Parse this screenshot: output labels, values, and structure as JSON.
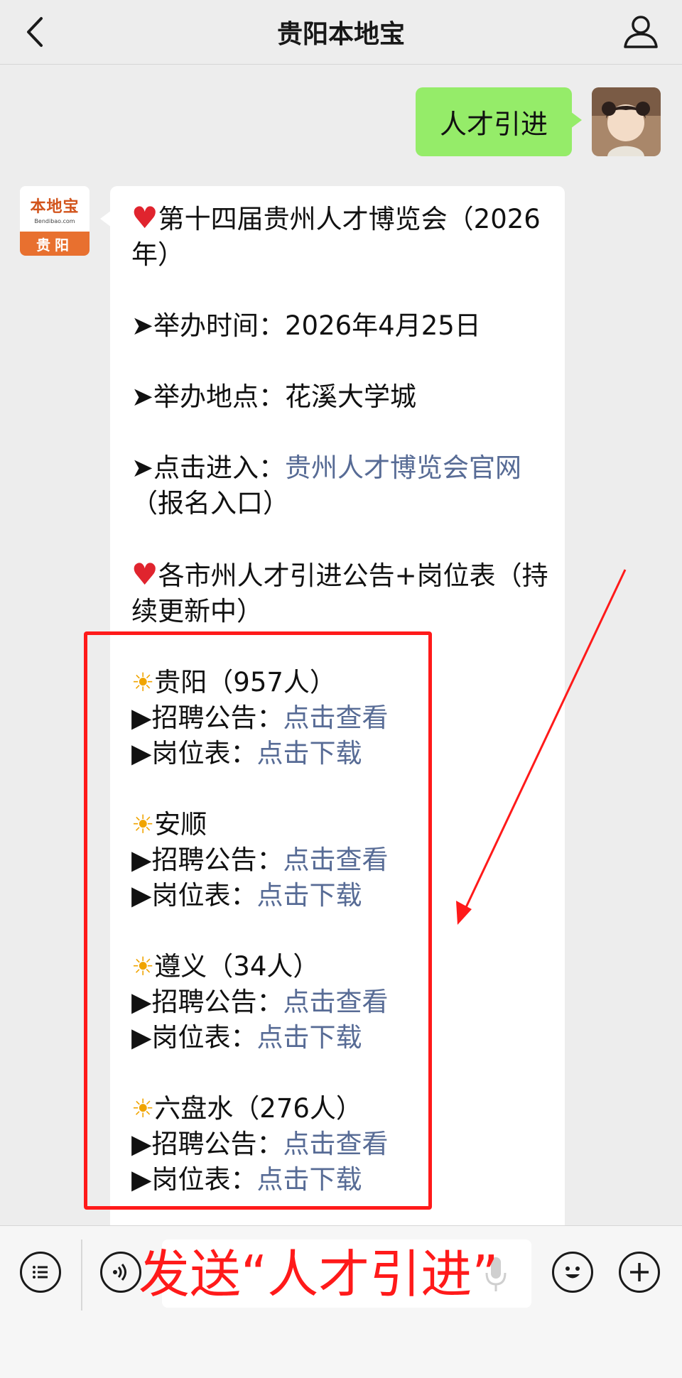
{
  "header": {
    "title": "贵阳本地宝",
    "back_icon": "chevron-left-icon",
    "profile_icon": "person-icon"
  },
  "sent_message": {
    "text": "人才引进"
  },
  "bot": {
    "avatar_logo": "本地宝",
    "avatar_sub": "Bendibao.com",
    "avatar_city": "贵阳"
  },
  "received_message": {
    "fair_heading": "第十四届贵州人才博览会（2026年）",
    "time_label": "➤举办时间：",
    "time_value": "2026年4月25日",
    "place_label": "➤举办地点：",
    "place_value": "花溪大学城",
    "enter_label": "➤点击进入：",
    "enter_link": "贵州人才博览会官网",
    "enter_suffix": "（报名入口）",
    "notice_heading": "各市州人才引进公告+岗位表（持续更新中）",
    "cities": [
      {
        "name": "贵阳（957人）",
        "notice_label": "▶招聘公告：",
        "notice_link": "点击查看",
        "table_label": "▶岗位表：",
        "table_link": "点击下载"
      },
      {
        "name": "安顺",
        "notice_label": "▶招聘公告：",
        "notice_link": "点击查看",
        "table_label": "▶岗位表：",
        "table_link": "点击下载"
      },
      {
        "name": "遵义（34人）",
        "notice_label": "▶招聘公告：",
        "notice_link": "点击查看",
        "table_label": "▶岗位表：",
        "table_link": "点击下载"
      },
      {
        "name": "六盘水（276人）",
        "notice_label": "▶招聘公告：",
        "notice_link": "点击查看",
        "table_label": "▶岗位表：",
        "table_link": "点击下载"
      }
    ]
  },
  "overlay_instruction": "发送“人才引进”",
  "input_bar": {
    "menu_icon": "list-menu-icon",
    "voice_icon": "voice-icon",
    "mic_icon": "microphone-icon",
    "emoji_icon": "emoji-icon",
    "plus_icon": "plus-icon"
  },
  "colors": {
    "sent_bubble": "#95ec69",
    "link": "#576b95",
    "annotation_red": "#ff1a1a",
    "background": "#ededed"
  }
}
